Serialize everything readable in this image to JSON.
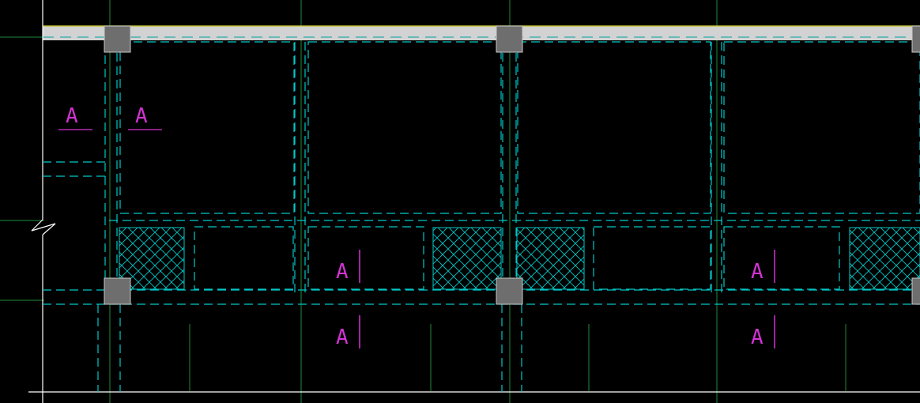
{
  "viewport": {
    "background": "#000000"
  },
  "colors": {
    "dashed_beam": "#00c8c8",
    "hatch": "#00c8c8",
    "grid_line": "#1f8c3a",
    "column_fill": "#6e6e6e",
    "column_stroke": "#c8c8c8",
    "wall_fill": "#d2d2d2",
    "wall_edge": "#c8c840",
    "annotation": "#d233d2",
    "boundary_line": "#ffffff"
  },
  "section_marks": [
    {
      "label": "A",
      "style": "underline"
    },
    {
      "label": "A",
      "style": "underline"
    },
    {
      "label": "A",
      "style": "side-bar"
    },
    {
      "label": "A",
      "style": "side-bar"
    },
    {
      "label": "A",
      "style": "side-bar"
    },
    {
      "label": "A",
      "style": "side-bar"
    }
  ],
  "icons": {
    "column": "square-column-icon",
    "break_line": "break-line-icon"
  }
}
